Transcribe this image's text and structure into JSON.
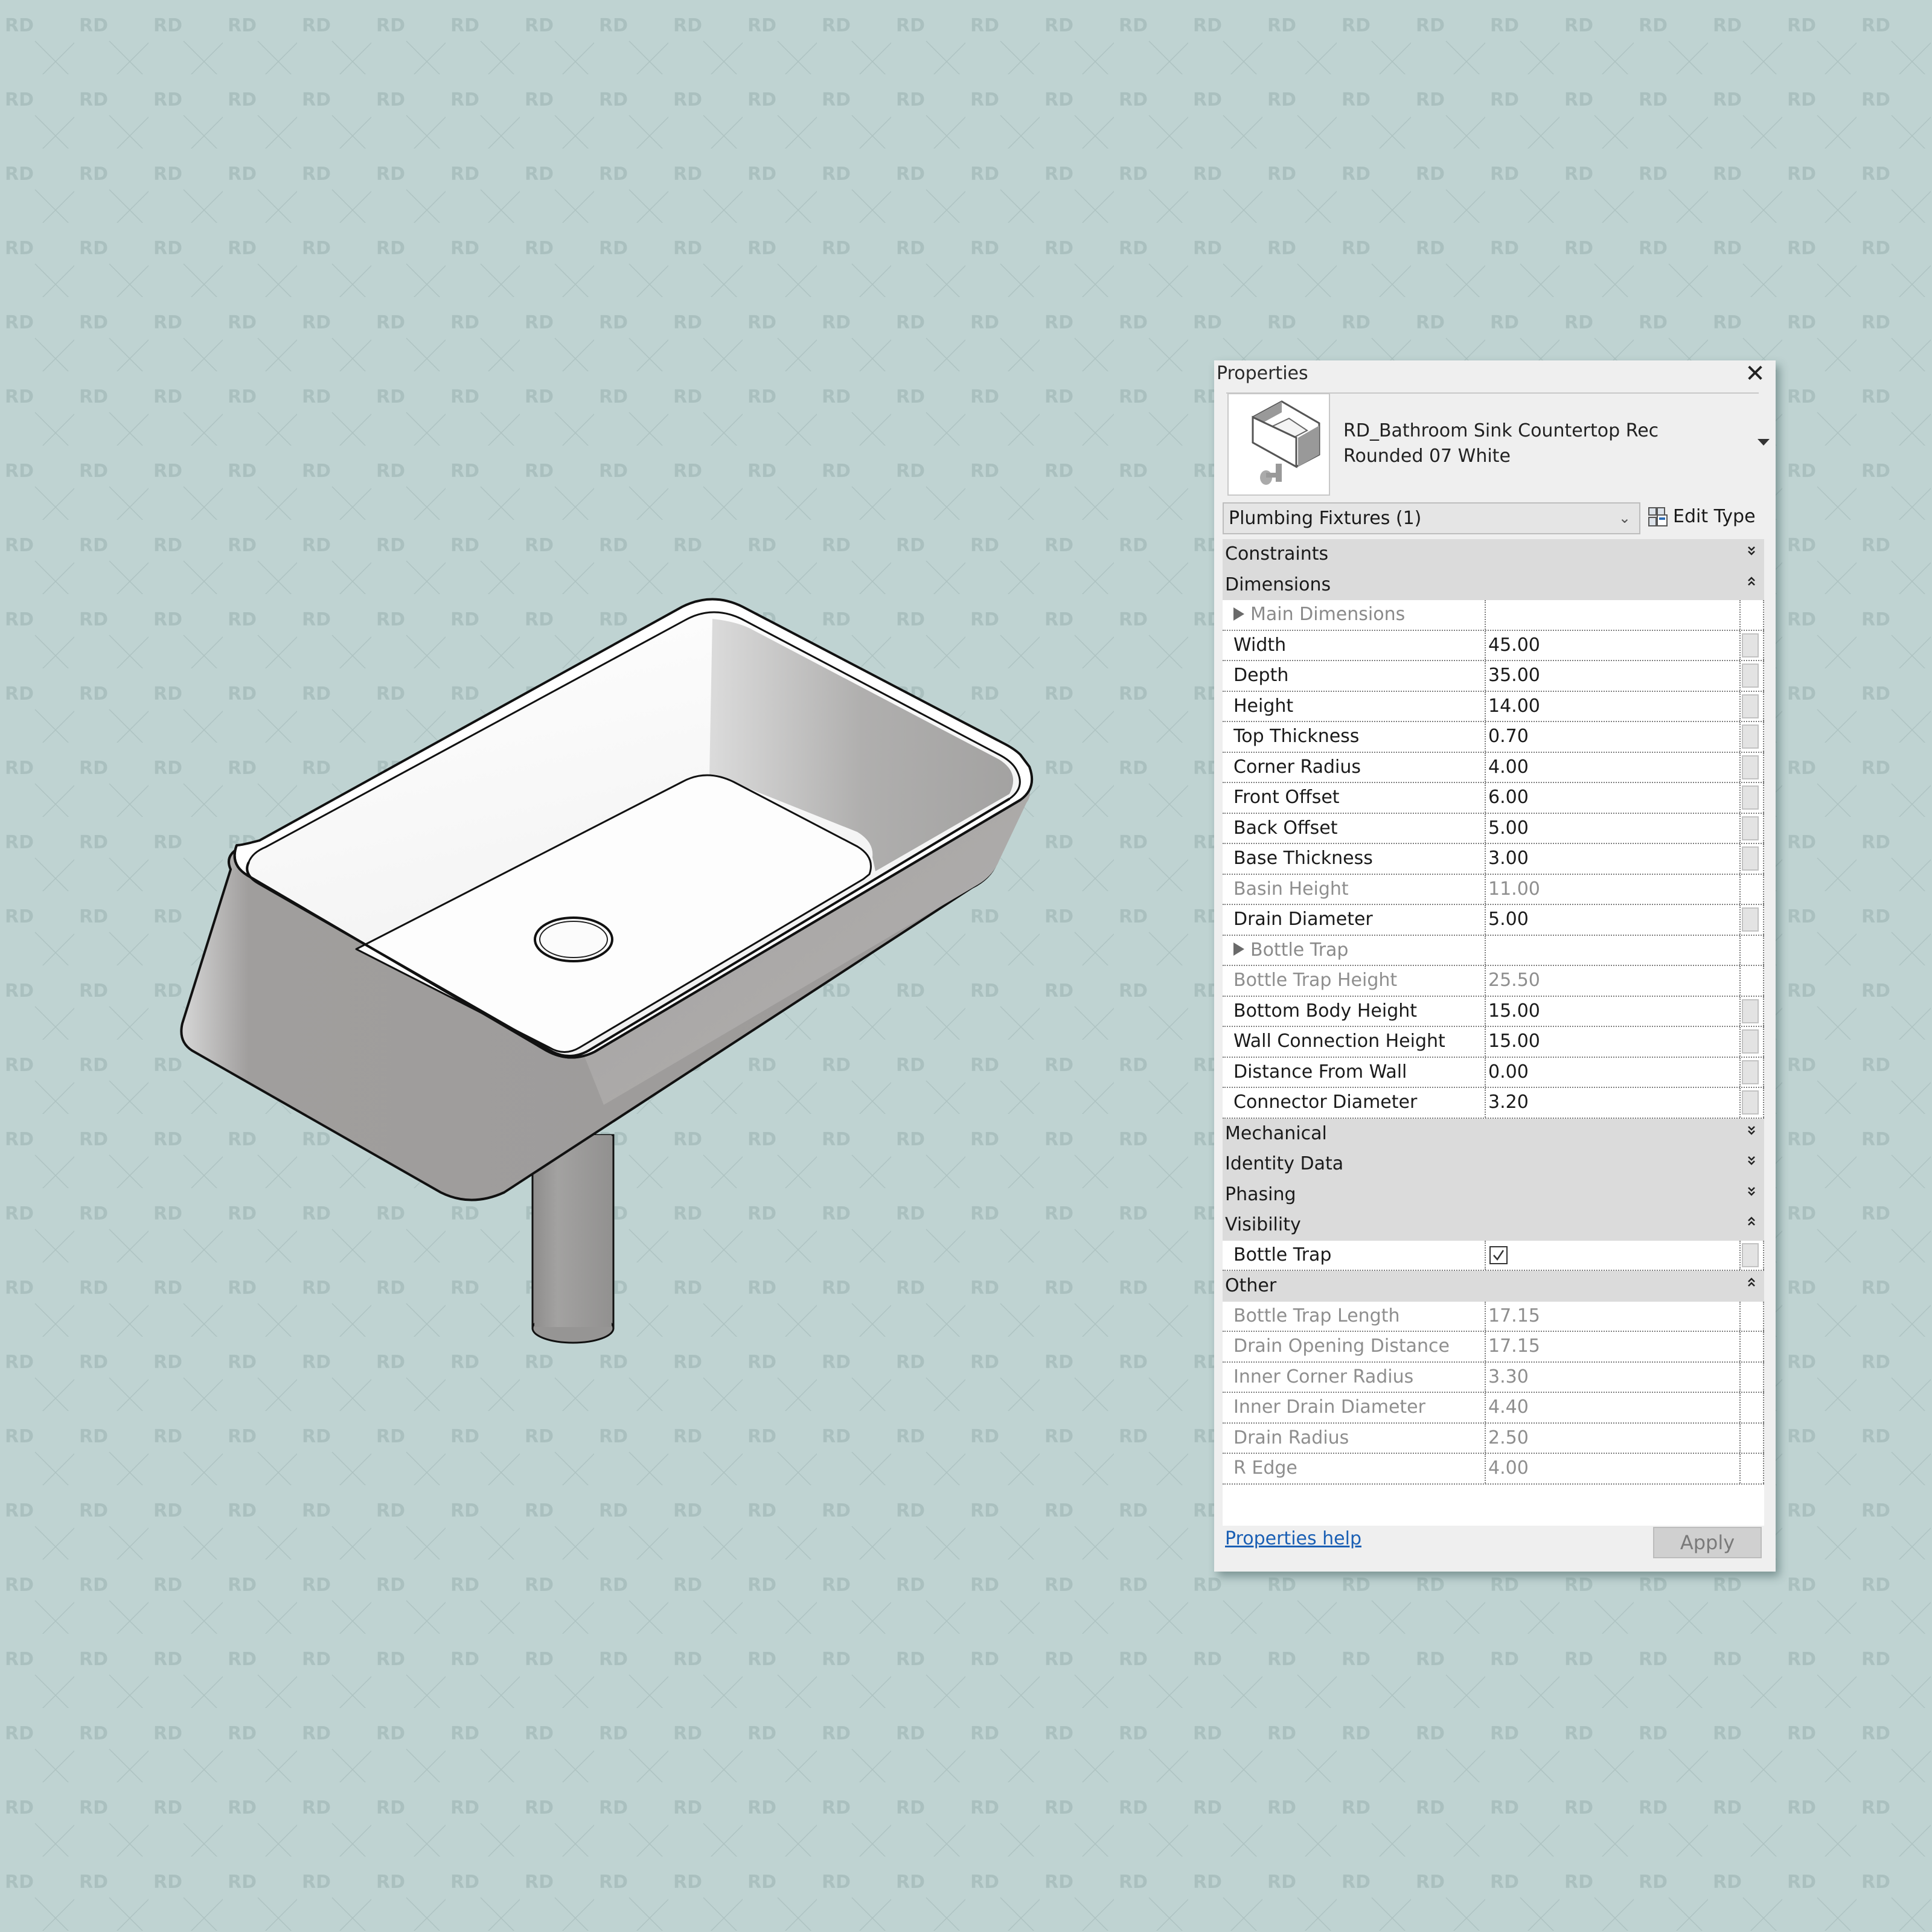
{
  "colors": {
    "background": "#bfd3d2",
    "watermark": "#a9bfbe",
    "panel_bg": "#efefef",
    "group_bg": "#dbdbdb",
    "link": "#1a5fb4"
  },
  "watermark": {
    "text": "RD",
    "icon": "x-cross-icon"
  },
  "properties": {
    "title": "Properties",
    "close_icon": "close-icon",
    "type_selector": {
      "name": "RD_Bathroom Sink Countertop Rec Rounded 07 White",
      "thumbnail_icon": "sink-thumbnail-icon",
      "dropdown_icon": "triangle-down-icon"
    },
    "category_filter": {
      "value": "Plumbing Fixtures (1)",
      "chevron_icon": "chevron-down-icon"
    },
    "edit_type": {
      "label": "Edit Type",
      "icon": "edit-type-icon"
    },
    "groups": [
      {
        "name": "Constraints",
        "expanded": false,
        "rows": []
      },
      {
        "name": "Dimensions",
        "expanded": true,
        "rows": [
          {
            "label": "Main Dimensions",
            "value": "",
            "kind": "subheader"
          },
          {
            "label": "Width",
            "value": "45.00",
            "editable": true
          },
          {
            "label": "Depth",
            "value": "35.00",
            "editable": true
          },
          {
            "label": "Height",
            "value": "14.00",
            "editable": true
          },
          {
            "label": "Top Thickness",
            "value": "0.70",
            "editable": true
          },
          {
            "label": "Corner Radius",
            "value": "4.00",
            "editable": true
          },
          {
            "label": "Front Offset",
            "value": "6.00",
            "editable": true
          },
          {
            "label": "Back Offset",
            "value": "5.00",
            "editable": true
          },
          {
            "label": "Base Thickness",
            "value": "3.00",
            "editable": true
          },
          {
            "label": "Basin Height",
            "value": "11.00",
            "editable": false
          },
          {
            "label": "Drain Diameter",
            "value": "5.00",
            "editable": true
          },
          {
            "label": "Bottle Trap",
            "value": "",
            "kind": "subheader"
          },
          {
            "label": "Bottle Trap Height",
            "value": "25.50",
            "editable": false
          },
          {
            "label": "Bottom Body Height",
            "value": "15.00",
            "editable": true
          },
          {
            "label": "Wall Connection Height",
            "value": "15.00",
            "editable": true
          },
          {
            "label": "Distance From Wall",
            "value": "0.00",
            "editable": true
          },
          {
            "label": "Connector Diameter",
            "value": "3.20",
            "editable": true
          }
        ]
      },
      {
        "name": "Mechanical",
        "expanded": false,
        "rows": []
      },
      {
        "name": "Identity Data",
        "expanded": false,
        "rows": []
      },
      {
        "name": "Phasing",
        "expanded": false,
        "rows": []
      },
      {
        "name": "Visibility",
        "expanded": true,
        "rows": [
          {
            "label": "Bottle Trap",
            "value": "",
            "kind": "checkbox",
            "checked": true,
            "editable": true
          }
        ]
      },
      {
        "name": "Other",
        "expanded": true,
        "rows": [
          {
            "label": "Bottle Trap Length",
            "value": "17.15",
            "editable": false
          },
          {
            "label": "Drain Opening Distance",
            "value": "17.15",
            "editable": false
          },
          {
            "label": "Inner Corner Radius",
            "value": "3.30",
            "editable": false
          },
          {
            "label": "Inner Drain Diameter",
            "value": "4.40",
            "editable": false
          },
          {
            "label": "Drain Radius",
            "value": "2.50",
            "editable": false
          },
          {
            "label": "R Edge",
            "value": "4.00",
            "editable": false
          }
        ]
      }
    ],
    "help_link": "Properties help",
    "apply_label": "Apply"
  }
}
